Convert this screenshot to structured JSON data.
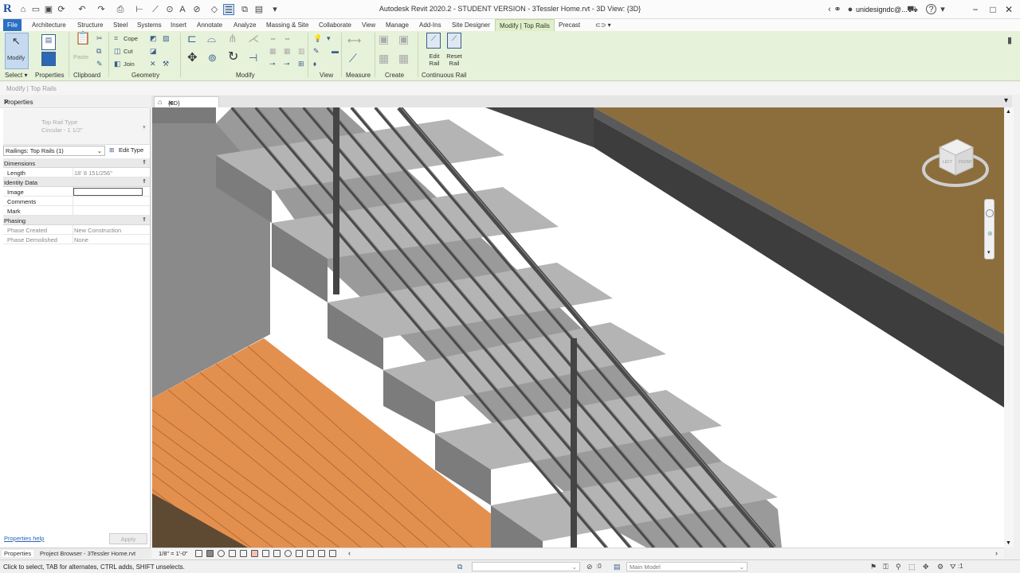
{
  "window": {
    "title": "Autodesk Revit 2020.2 - STUDENT VERSION - 3Tessler Home.rvt - 3D View: {3D}",
    "user": "unidesigndc@..."
  },
  "tabs": [
    "File",
    "Architecture",
    "Structure",
    "Steel",
    "Systems",
    "Insert",
    "Annotate",
    "Analyze",
    "Massing & Site",
    "Collaborate",
    "View",
    "Manage",
    "Add-Ins",
    "Site Designer",
    "Modify | Top Rails",
    "Precast"
  ],
  "ribbon": {
    "modify_label": "Modify",
    "select_label": "Select",
    "properties_label": "Properties",
    "clipboard_label": "Clipboard",
    "paste_label": "Paste",
    "geometry_label": "Geometry",
    "cope_label": "Cope",
    "cut_label": "Cut",
    "join_label": "Join",
    "modify_group_label": "Modify",
    "view_label": "View",
    "measure_label": "Measure",
    "create_label": "Create",
    "edit_rail_label": "Edit Rail",
    "reset_rail_label": "Reset Rail",
    "continuous_rail_label": "Continuous Rail"
  },
  "context_bar": "Modify | Top Rails",
  "properties": {
    "title": "Properties",
    "type_line1": "Top Rail Type",
    "type_line2": "Circular - 1 1/2\"",
    "type_selector": "Railings: Top Rails (1)",
    "edit_type": "Edit Type",
    "sections": {
      "dimensions": "Dimensions",
      "identity": "Identity Data",
      "phasing": "Phasing"
    },
    "rows": {
      "length_k": "Length",
      "length_v": "18'  8 151/256\"",
      "image_k": "Image",
      "comments_k": "Comments",
      "mark_k": "Mark",
      "phase_created_k": "Phase Created",
      "phase_created_v": "New Construction",
      "phase_demolished_k": "Phase Demolished",
      "phase_demolished_v": "None"
    },
    "help": "Properties help",
    "apply": "Apply"
  },
  "bottom_tabs": {
    "properties": "Properties",
    "project_browser": "Project Browser - 3Tessler Home.rvt"
  },
  "view_tab": "{3D}",
  "view_controls": {
    "scale": "1/8\" = 1'-0\""
  },
  "viewcube": {
    "left": "LEFT",
    "front": "FRONT"
  },
  "status": {
    "text": "Click to select, TAB for alternates, CTRL adds, SHIFT unselects.",
    "count": ":0",
    "model": "Main Model",
    "filter": ":1"
  },
  "colors": {
    "ribbon_bg": "#e6f2d9",
    "file_tab": "#2970c4",
    "deck_wood": "#e3904f",
    "roof_brown": "#8c6d3c",
    "tread": "#8e8e8e"
  }
}
